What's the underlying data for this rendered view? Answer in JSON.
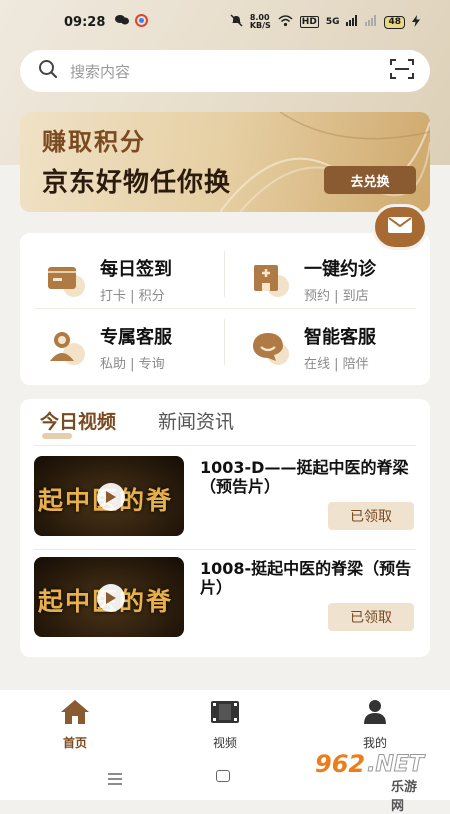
{
  "status_bar": {
    "time": "09:28",
    "net_speed": "8.00\nKB/S",
    "hd": "HD",
    "signal": "5G",
    "battery": "48"
  },
  "search": {
    "placeholder": "搜索内容"
  },
  "banner": {
    "title": "赚取积分",
    "subtitle": "京东好物任你换",
    "button": "去兑换"
  },
  "services": [
    {
      "title": "每日签到",
      "sub": "打卡 | 积分",
      "icon": "checkin-card-icon"
    },
    {
      "title": "一键约诊",
      "sub": "预约 | 到店",
      "icon": "clinic-icon"
    },
    {
      "title": "专属客服",
      "sub": "私助 | 专询",
      "icon": "service-agent-icon"
    },
    {
      "title": "智能客服",
      "sub": "在线 | 陪伴",
      "icon": "chat-bubble-icon"
    }
  ],
  "news": {
    "tabs": [
      {
        "label": "今日视频",
        "active": true
      },
      {
        "label": "新闻资讯",
        "active": false
      }
    ],
    "videos": [
      {
        "title": "1003-D——挺起中医的脊梁（预告片）",
        "thumb_text": "起中医的脊",
        "button": "已领取"
      },
      {
        "title": "1008-挺起中医的脊梁（预告片）",
        "thumb_text": "起中医的脊",
        "button": "已领取"
      }
    ]
  },
  "tabbar": [
    {
      "label": "首页",
      "icon": "home-icon",
      "active": true
    },
    {
      "label": "视频",
      "icon": "film-icon",
      "active": false
    },
    {
      "label": "我的",
      "icon": "user-icon",
      "active": false
    }
  ],
  "watermark": {
    "brand_num": "962",
    "brand_net": ".NET",
    "brand_sub": "乐游网"
  },
  "colors": {
    "accent": "#7a4a21",
    "brand_button": "#8a5a30",
    "claim_bg": "#efe3d0"
  }
}
